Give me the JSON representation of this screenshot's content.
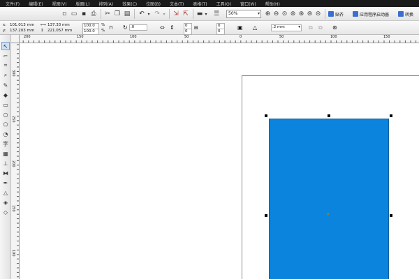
{
  "menu": [
    "文件(F)",
    "编辑(E)",
    "视图(V)",
    "版面(L)",
    "排列(A)",
    "效果(C)",
    "位图(B)",
    "文本(T)",
    "表格(T)",
    "工具(O)",
    "窗口(W)",
    "帮助(H)"
  ],
  "toolbar": {
    "zoom_value": "50%",
    "snap_label": "贴齐",
    "app_launcher_label": "应用程序启动器",
    "transfer_label": "转换"
  },
  "properties": {
    "x": "101.013 mm",
    "y": "137.203 mm",
    "width": "137.33 mm",
    "height": "221.057 mm",
    "scale_x": "100.0",
    "scale_y": "100.0",
    "percent_x": "%",
    "percent_y": "%",
    "rotation": ".0",
    "corner_top_left": "0",
    "corner_bottom_left": "0",
    "corner_top_right": "0",
    "corner_bottom_right": "0",
    "outline_width": ".2 mm"
  },
  "ruler_top_labels": [
    "200",
    "150",
    "100",
    "50",
    "0",
    "50",
    "100",
    "150"
  ],
  "ruler_left_labels": [
    "300",
    "250",
    "200",
    "150",
    "100"
  ],
  "colors": {
    "rect_fill": "#0a84dd",
    "menubar_bg": "#1a1a1a",
    "canvas_bg": "#ffffff"
  }
}
